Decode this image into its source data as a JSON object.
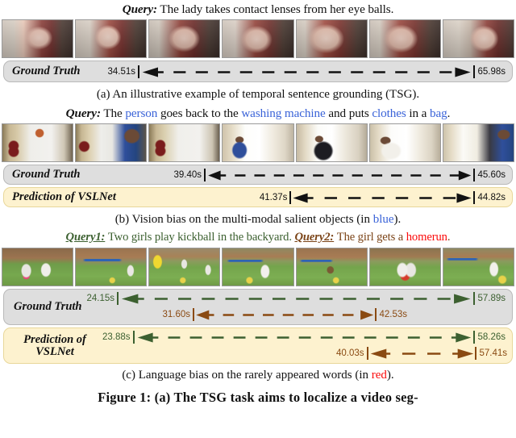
{
  "colors": {
    "blue": "#3a63d8",
    "red": "#fb0a0a",
    "green": "#3c6030",
    "brown": "#7b4418",
    "black": "#111111",
    "gt_bg": "#dedede",
    "pred_bg": "#fdf2cf"
  },
  "panel_a": {
    "query": {
      "label": "Query:",
      "text": "The lady takes contact lenses from her eye balls."
    },
    "frames": [
      {
        "alt": "woman holding contact lens near face"
      },
      {
        "alt": "woman looking at camera"
      },
      {
        "alt": "woman touching eye"
      },
      {
        "alt": "woman covering eye with hand"
      },
      {
        "alt": "close up of inserting lens"
      },
      {
        "alt": "woman blinking with hand at eye"
      },
      {
        "alt": "woman looking down"
      }
    ],
    "rows": [
      {
        "name": "Ground Truth",
        "style": "gt",
        "bars": [
          {
            "start": "34.51s",
            "end": "65.98s",
            "color": "#111111",
            "left_pct": 0.0,
            "right_pct": 100.0
          }
        ]
      }
    ],
    "caption": "(a) An illustrative example of temporal sentence grounding (TSG)."
  },
  "panel_b": {
    "query": {
      "label": "Query:",
      "segments": [
        {
          "text": "The ",
          "color": "black"
        },
        {
          "text": "person",
          "color": "blue"
        },
        {
          "text": " goes back to the ",
          "color": "black"
        },
        {
          "text": "washing machine",
          "color": "blue"
        },
        {
          "text": " and puts ",
          "color": "black"
        },
        {
          "text": "clothes",
          "color": "blue"
        },
        {
          "text": " in a ",
          "color": "black"
        },
        {
          "text": "bag",
          "color": "blue"
        },
        {
          "text": ".",
          "color": "black"
        }
      ]
    },
    "frames": [
      {
        "alt": "kitchen with washing machine"
      },
      {
        "alt": "man in blue shirt bending over"
      },
      {
        "alt": "empty kitchen washing machine"
      },
      {
        "alt": "man at closet with clothes"
      },
      {
        "alt": "man holding dark clothes"
      },
      {
        "alt": "man putting clothes in bag"
      },
      {
        "alt": "man turning away from closet"
      }
    ],
    "rows": [
      {
        "name": "Ground Truth",
        "style": "gt",
        "bars": [
          {
            "start": "39.40s",
            "end": "45.60s",
            "color": "#111111",
            "left_pct": 30.0,
            "right_pct": 100.0
          }
        ]
      },
      {
        "name": "Prediction of VSLNet",
        "style": "pred",
        "bars": [
          {
            "start": "41.37s",
            "end": "44.82s",
            "color": "#111111",
            "left_pct": 50.0,
            "right_pct": 100.0
          }
        ]
      }
    ],
    "caption_pre": "(b) Vision bias on the multi-modal salient objects (in ",
    "caption_kw": "blue",
    "caption_post": ")."
  },
  "panel_c": {
    "query1": {
      "label": "Query1:",
      "text": "Two girls play kickball in the backyard."
    },
    "query2": {
      "label": "Query2:",
      "pre": "The girl gets a ",
      "kw": "homerun",
      "post": "."
    },
    "frames": [
      {
        "alt": "two girls standing on grass"
      },
      {
        "alt": "girl with ball by trampoline"
      },
      {
        "alt": "yellow slide and girls in yard"
      },
      {
        "alt": "girl running on grass"
      },
      {
        "alt": "dog in backyard"
      },
      {
        "alt": "girls with red ball"
      },
      {
        "alt": "girl running past trampoline"
      }
    ],
    "rows": [
      {
        "name": "Ground Truth",
        "style": "gt",
        "bars": [
          {
            "start": "24.15s",
            "end": "57.89s",
            "color": "#3c6030",
            "left_pct": 0.0,
            "right_pct": 100.0
          },
          {
            "start": "31.60s",
            "end": "42.53s",
            "color": "#8a4a12",
            "left_pct": 20.0,
            "right_pct": 68.0
          }
        ]
      },
      {
        "name": "Prediction of VSLNet",
        "style": "pred",
        "bars": [
          {
            "start": "23.88s",
            "end": "58.26s",
            "color": "#3c6030",
            "left_pct": 0.0,
            "right_pct": 100.0
          },
          {
            "start": "40.03s",
            "end": "57.41s",
            "color": "#8a4a12",
            "left_pct": 59.0,
            "right_pct": 94.0
          }
        ]
      }
    ],
    "caption_pre": "(c) Language bias on the rarely appeared words (in ",
    "caption_kw": "red",
    "caption_post": ")."
  },
  "figure_caption": "Figure 1: (a) The TSG task aims to localize a video seg-"
}
